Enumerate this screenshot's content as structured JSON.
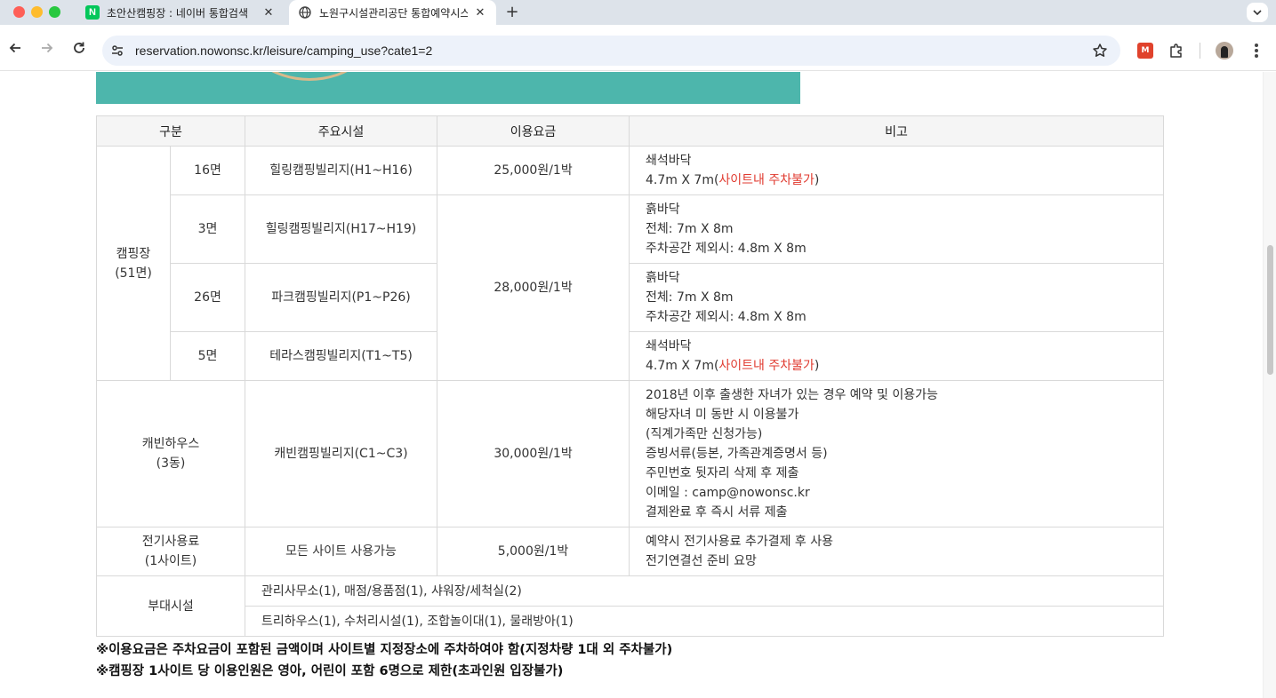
{
  "browser": {
    "tabs": [
      {
        "title": "초안산캠핑장 : 네이버 통합검색",
        "favicon": "naver-icon",
        "active": false
      },
      {
        "title": "노원구시설관리공단 통합예약시스템",
        "favicon": "globe-icon",
        "active": true
      }
    ],
    "url": "reservation.nowonsc.kr/leisure/camping_use?cate1=2"
  },
  "table": {
    "headers": [
      "구분",
      "주요시설",
      "이용요금",
      "비고"
    ],
    "camping_group": "캠핑장\n(51면)",
    "rows": [
      {
        "count": "16면",
        "facility": "힐링캠핑빌리지(H1~H16)",
        "price": "25,000원/1박",
        "note_line1": "쇄석바닥",
        "note_line2_prefix": "4.7m X 7m(",
        "note_line2_red": "사이트내 주차불가",
        "note_line2_suffix": ")"
      },
      {
        "count": "3면",
        "facility": "힐링캠핑빌리지(H17~H19)",
        "price": "28,000원/1박",
        "note_line1": "흙바닥",
        "note_line2": "전체: 7m X 8m",
        "note_line3": "주차공간 제외시: 4.8m X 8m"
      },
      {
        "count": "26면",
        "facility": "파크캠핑빌리지(P1~P26)",
        "note_line1": "흙바닥",
        "note_line2": "전체: 7m X 8m",
        "note_line3": "주차공간 제외시: 4.8m X 8m"
      },
      {
        "count": "5면",
        "facility": "테라스캠핑빌리지(T1~T5)",
        "note_line1": "쇄석바닥",
        "note_line2_prefix": "4.7m X 7m(",
        "note_line2_red": "사이트내 주차불가",
        "note_line2_suffix": ")"
      }
    ],
    "cabin": {
      "group": "캐빈하우스\n(3동)",
      "facility": "캐빈캠핑빌리지(C1~C3)",
      "price": "30,000원/1박",
      "notes": [
        "2018년 이후 출생한 자녀가 있는 경우 예약 및 이용가능",
        "해당자녀 미 동반 시 이용불가",
        "(직계가족만 신청가능)",
        "증빙서류(등본, 가족관계증명서 등)",
        "주민번호 뒷자리 삭제 후 제출",
        "이메일 : camp@nowonsc.kr",
        "결제완료 후 즉시 서류 제출"
      ]
    },
    "electric": {
      "group": "전기사용료\n(1사이트)",
      "facility": "모든 사이트 사용가능",
      "price": "5,000원/1박",
      "notes": [
        "예약시 전기사용료 추가결제 후 사용",
        "전기연결선 준비 요망"
      ]
    },
    "amenities": {
      "group": "부대시설",
      "line1": "관리사무소(1), 매점/용품점(1), 샤워장/세척실(2)",
      "line2": "트리하우스(1), 수처리시설(1), 조합놀이대(1), 물래방아(1)"
    }
  },
  "footnotes": [
    "※이용요금은 주차요금이 포함된 금액이며 사이트별 지정장소에 주차하여야 함(지정차량 1대 외 주차불가)",
    "※캠핑장 1사이트 당 이용인원은 영아, 어린이 포함 6명으로 제한(초과인원 입장불가)"
  ],
  "colors": {
    "accent_red": "#e03a2f",
    "banner": "#4db6ac",
    "header_bg": "#f5f5f5"
  }
}
